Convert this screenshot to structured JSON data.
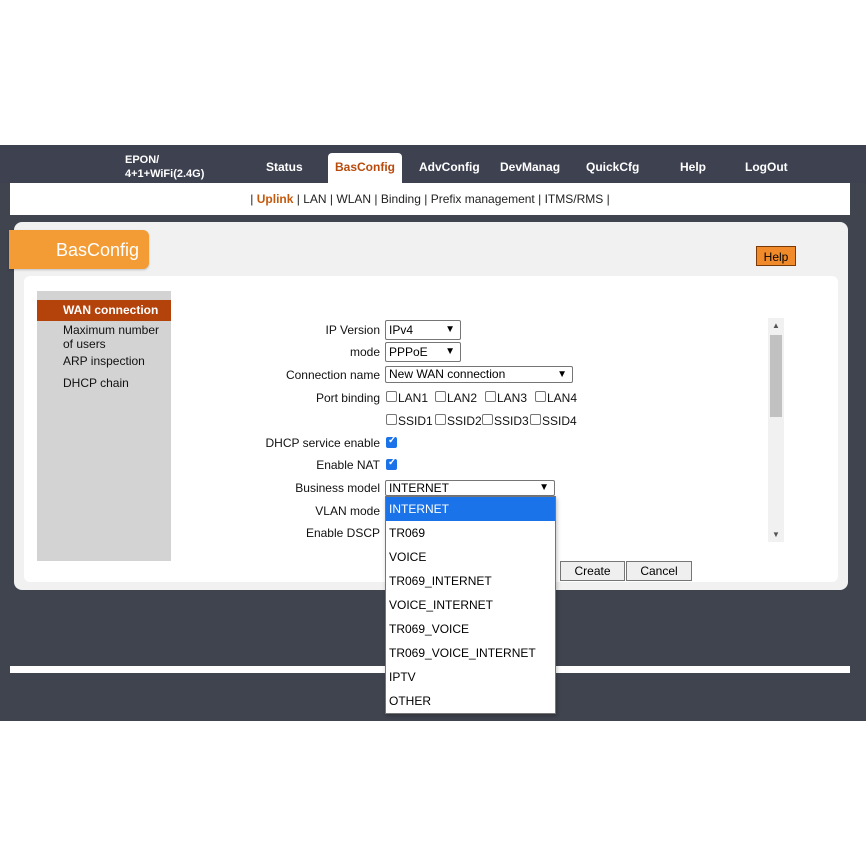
{
  "header": {
    "brand_line1": "EPON/",
    "brand_line2": "4+1+WiFi(2.4G)",
    "nav": {
      "status": "Status",
      "basconfig": "BasConfig",
      "advconfig": "AdvConfig",
      "devmanag": "DevManag",
      "quickcfg": "QuickCfg",
      "help": "Help",
      "logout": "LogOut"
    }
  },
  "subnav": {
    "sep": "|",
    "items": [
      "Uplink",
      "LAN",
      "WLAN",
      "Binding",
      "Prefix management",
      "ITMS/RMS"
    ]
  },
  "section_title": "BasConfig",
  "help_button": "Help",
  "sidebar": {
    "items": [
      "WAN connection",
      "Maximum number of users",
      "ARP inspection",
      "DHCP chain"
    ]
  },
  "form": {
    "ip_version": {
      "label": "IP Version",
      "value": "IPv4"
    },
    "mode": {
      "label": "mode",
      "value": "PPPoE"
    },
    "connection_name": {
      "label": "Connection name",
      "value": "New WAN connection"
    },
    "port_binding": {
      "label": "Port binding",
      "ports": [
        "LAN1",
        "LAN2",
        "LAN3",
        "LAN4",
        "SSID1",
        "SSID2",
        "SSID3",
        "SSID4"
      ]
    },
    "dhcp_service": {
      "label": "DHCP service enable",
      "checked": true
    },
    "enable_nat": {
      "label": "Enable NAT",
      "checked": true
    },
    "business_model": {
      "label": "Business model",
      "value": "INTERNET"
    },
    "vlan_mode": {
      "label": "VLAN mode"
    },
    "enable_dscp": {
      "label": "Enable DSCP"
    }
  },
  "buttons": {
    "create": "Create",
    "cancel": "Cancel"
  },
  "dropdown": {
    "options": [
      "INTERNET",
      "TR069",
      "VOICE",
      "TR069_INTERNET",
      "VOICE_INTERNET",
      "TR069_VOICE",
      "TR069_VOICE_INTERNET",
      "IPTV",
      "OTHER"
    ],
    "highlighted": "INTERNET"
  },
  "colors": {
    "accent": "#b4420b",
    "orange": "#f39c35",
    "select_blue": "#1a73e8"
  }
}
